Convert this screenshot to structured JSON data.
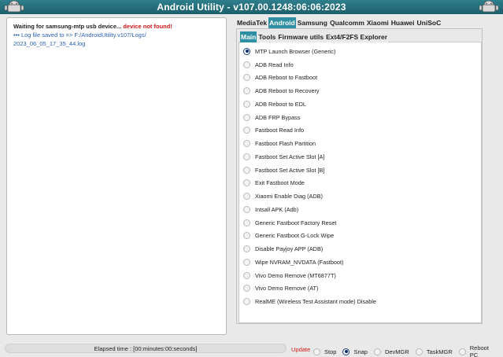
{
  "window": {
    "title": "Android Utility - v107.00.1248:06:06:2023"
  },
  "log": {
    "line1_text": "Waiting for samsung-mtp usb device... ",
    "line1_error": "device not found!",
    "line2": "••• Log file saved to => F:/AndroidUtility.v107/Logs/",
    "line3": "2023_06_05_17_35_44.log"
  },
  "tabs": [
    {
      "label": "MediaTek",
      "active": false
    },
    {
      "label": "Android",
      "active": true
    },
    {
      "label": "Samsung",
      "active": false
    },
    {
      "label": "Qualcomm",
      "active": false
    },
    {
      "label": "Xiaomi",
      "active": false
    },
    {
      "label": "Huawei",
      "active": false
    },
    {
      "label": "UniSoC",
      "active": false
    }
  ],
  "subtabs": [
    {
      "label": "Main",
      "active": true
    },
    {
      "label": "Tools",
      "active": false
    },
    {
      "label": "Firmware utils",
      "active": false
    },
    {
      "label": "Ext4/F2FS Explorer",
      "active": false
    }
  ],
  "options": [
    {
      "label": "MTP Launch Browser (Generic)",
      "checked": true
    },
    {
      "label": "ADB Read Info",
      "checked": false
    },
    {
      "label": "ADB Reboot to Fastboot",
      "checked": false
    },
    {
      "label": "ADB Reboot to Recovery",
      "checked": false
    },
    {
      "label": "ADB Reboot to EDL",
      "checked": false
    },
    {
      "label": "ADB FRP Bypass",
      "checked": false
    },
    {
      "label": "Fastboot Read Info",
      "checked": false
    },
    {
      "label": "Fastboot Flash Partition",
      "checked": false
    },
    {
      "label": "Fastboot Set Active Slot [A]",
      "checked": false
    },
    {
      "label": "Fastboot Set Active Slot [B]",
      "checked": false
    },
    {
      "label": "Exit Fastboot Mode",
      "checked": false
    },
    {
      "label": "Xiaomi Enable Diag (ADB)",
      "checked": false
    },
    {
      "label": "Intsall APK (Adb)",
      "checked": false
    },
    {
      "label": "Generic Fastboot Factory Reset",
      "checked": false
    },
    {
      "label": "Generic Fastboot G-Lock Wipe",
      "checked": false
    },
    {
      "label": "Disable Payjoy APP (ADB)",
      "checked": false
    },
    {
      "label": "Wipe NVRAM_NVDATA (Fastboot)",
      "checked": false
    },
    {
      "label": "Vivo Demo Remove (MT6877T)",
      "checked": false
    },
    {
      "label": "Vivo Demo Remove (AT)",
      "checked": false
    },
    {
      "label": "RealME (Wireless Test Assistant mode) Disable",
      "checked": false
    }
  ],
  "status": {
    "elapsed": "Elapsed time : [00:minutes:00:seconds]",
    "update_label": "Update",
    "options": [
      {
        "label": "Stop",
        "checked": false
      },
      {
        "label": "Snap",
        "checked": true
      },
      {
        "label": "DevMGR",
        "checked": false
      },
      {
        "label": "TaskMGR",
        "checked": false
      },
      {
        "label": "Reboot PC",
        "checked": false
      }
    ]
  },
  "colors": {
    "titlebar": "#2f7f8c",
    "active_tab": "#2f8fa3",
    "error": "#d01818",
    "log_link": "#2a5fb0"
  },
  "icons": {
    "title_left": "android-robot-icon",
    "title_right": "android-robot-icon"
  }
}
